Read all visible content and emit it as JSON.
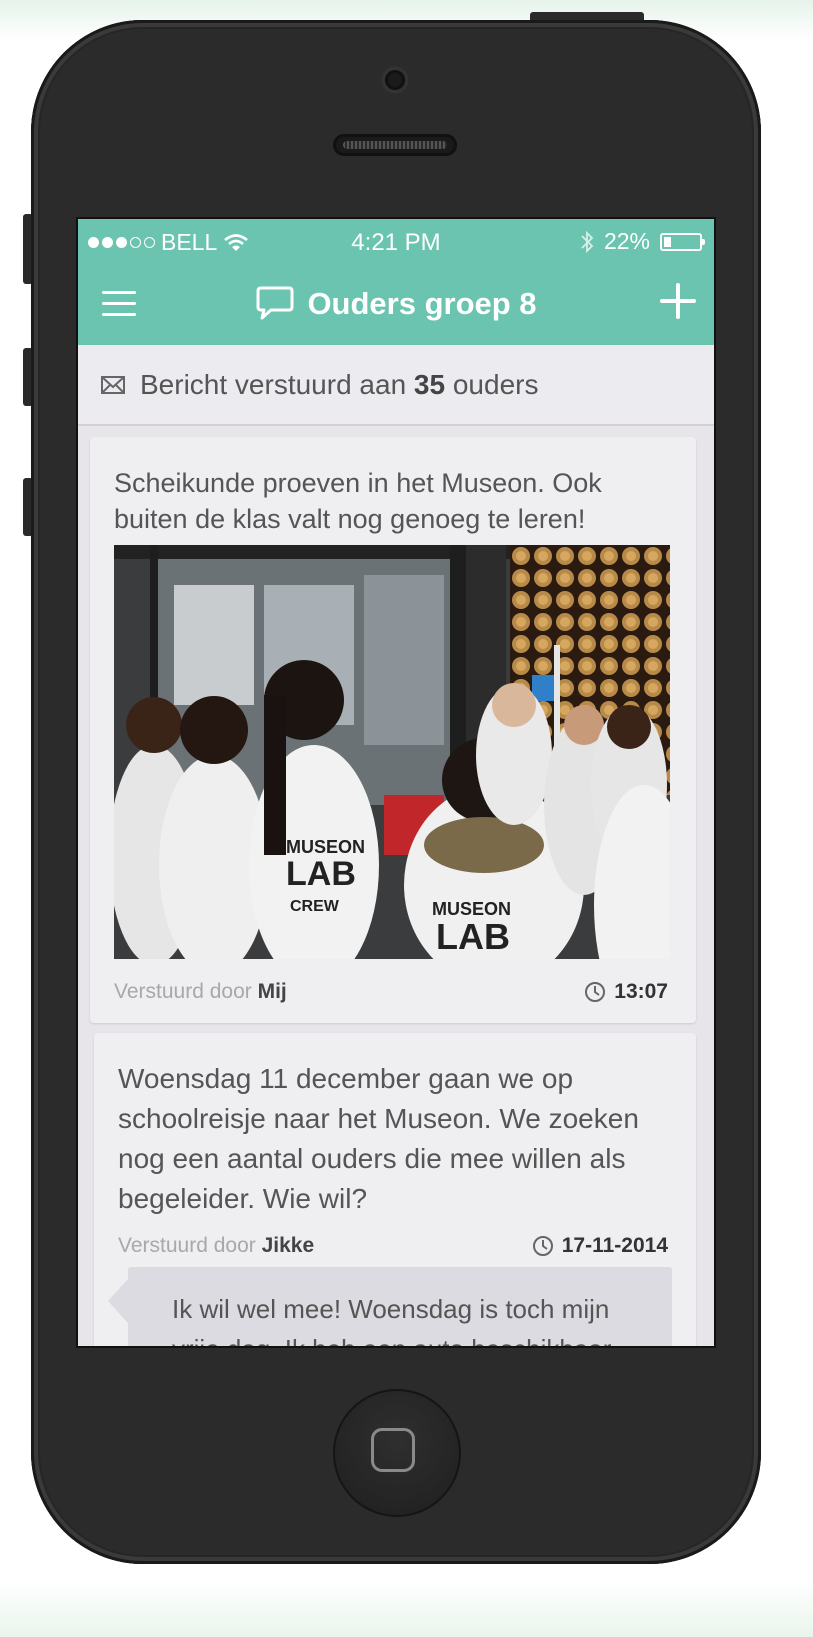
{
  "status_bar": {
    "carrier": "BELL",
    "time": "4:21 PM",
    "battery": "22%",
    "battery_level": 0.22
  },
  "nav": {
    "title": "Ouders groep 8"
  },
  "sent_notice": {
    "prefix": "Bericht verstuurd aan",
    "count": "35",
    "suffix": "ouders"
  },
  "messages": [
    {
      "text": "Scheikunde proeven in het Museon. Ook buiten de klas valt nog genoeg te leren!",
      "sent_by_label": "Verstuurd door",
      "sender": "Mij",
      "time": "13:07"
    },
    {
      "text": "Woensdag 11 december gaan we op schoolreisje naar het Museon. We zoeken nog een aantal ouders die mee willen als begeleider. Wie wil?",
      "sent_by_label": "Verstuurd door",
      "sender": "Jikke",
      "time": "17-11-2014",
      "reply": "Ik wil wel mee! Woensdag is toch mijn vrije dag. Ik heb een auto beschikbaar"
    }
  ],
  "photo_labels": {
    "coat_text_1": "MUSEON",
    "coat_text_2": "LAB",
    "coat_text_3": "CREW"
  },
  "colors": {
    "accent": "#6bc4b0",
    "background": "#e7e5ea"
  },
  "icons": [
    "wifi-icon",
    "bluetooth-icon",
    "battery-icon",
    "menu-icon",
    "chat-bubble-icon",
    "plus-icon",
    "envelope-icon",
    "clock-icon"
  ]
}
